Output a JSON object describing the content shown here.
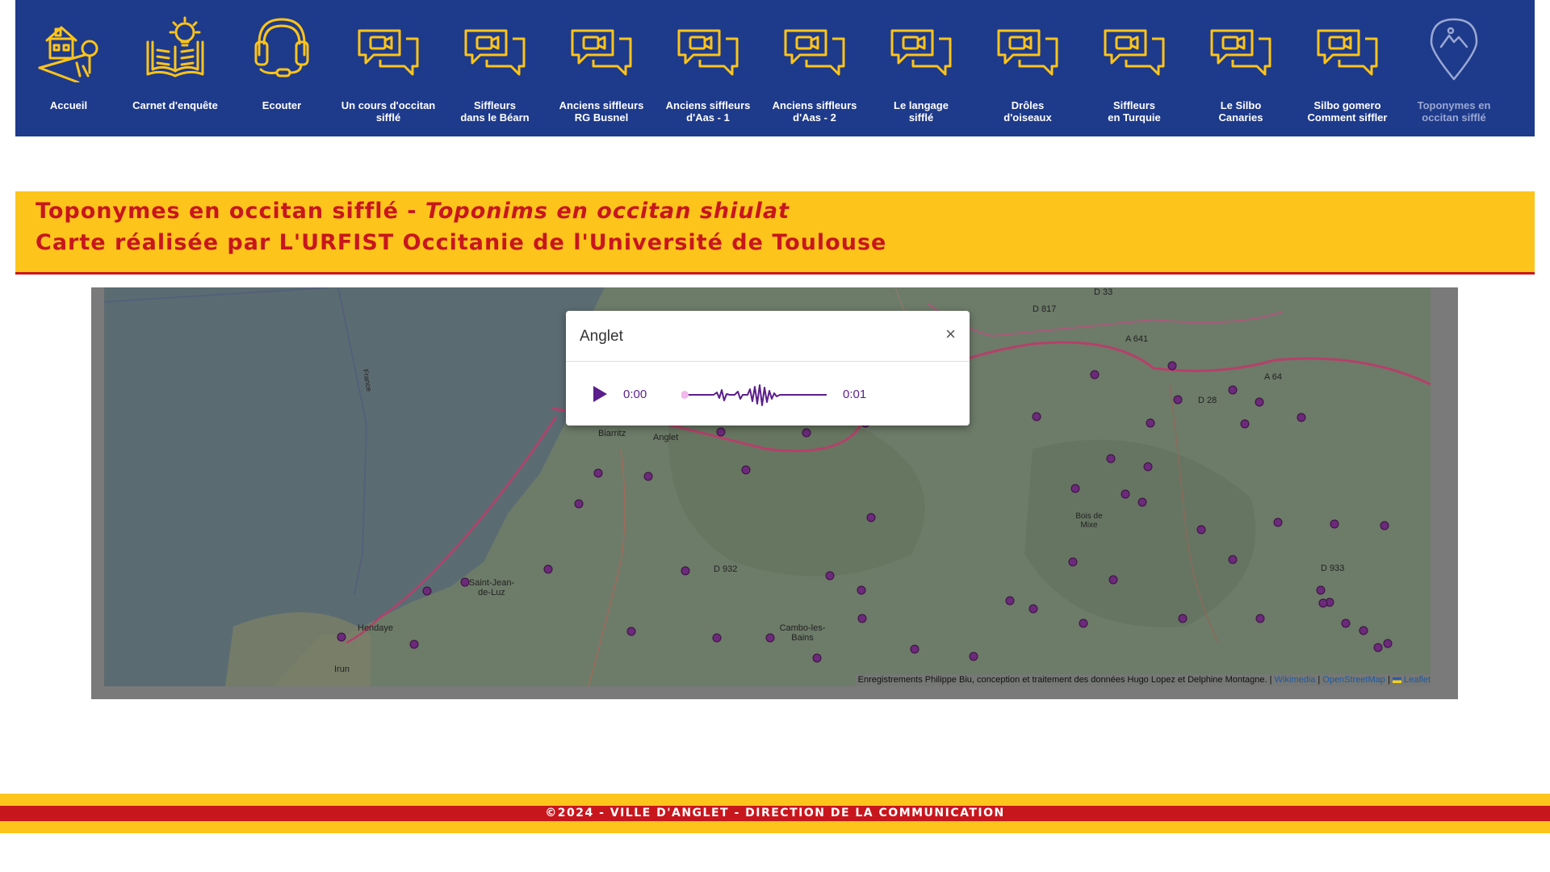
{
  "nav": {
    "items": [
      {
        "label1": "Accueil",
        "label2": "",
        "icon": "house-icon"
      },
      {
        "label1": "Carnet d'enquête",
        "label2": "",
        "icon": "notebook-idea-icon"
      },
      {
        "label1": "Ecouter",
        "label2": "",
        "icon": "headphones-icon"
      },
      {
        "label1": "Un cours d'occitan",
        "label2": "sifflé",
        "icon": "video-chat-icon"
      },
      {
        "label1": "Siffleurs",
        "label2": "dans le Béarn",
        "icon": "video-chat-icon"
      },
      {
        "label1": "Anciens siffleurs",
        "label2": "RG Busnel",
        "icon": "video-chat-icon"
      },
      {
        "label1": "Anciens siffleurs",
        "label2": "d'Aas - 1",
        "icon": "video-chat-icon"
      },
      {
        "label1": "Anciens siffleurs",
        "label2": "d'Aas - 2",
        "icon": "video-chat-icon"
      },
      {
        "label1": "Le langage",
        "label2": "sifflé",
        "icon": "video-chat-icon"
      },
      {
        "label1": "Drôles",
        "label2": "d'oiseaux",
        "icon": "video-chat-icon"
      },
      {
        "label1": "Siffleurs",
        "label2": "en Turquie",
        "icon": "video-chat-icon"
      },
      {
        "label1": "Le Silbo",
        "label2": "Canaries",
        "icon": "video-chat-icon"
      },
      {
        "label1": "Silbo gomero",
        "label2": "Comment siffler",
        "icon": "video-chat-icon"
      },
      {
        "label1": "Toponymes en",
        "label2": "occitan sifflé",
        "icon": "map-pin-icon",
        "active": true
      }
    ]
  },
  "banner": {
    "line1_fr": "Toponymes en occitan sifflé - ",
    "line1_oc": "Toponims en occitan shiulat",
    "line2": "Carte réalisée par L'URFIST Occitanie de l'Université de Toulouse"
  },
  "map": {
    "labels": [
      "D 33",
      "D 817",
      "A 641",
      "A 64",
      "D 28",
      "Biarritz",
      "Anglet",
      "Saint-Jean-de-Luz",
      "Hendaye",
      "Irun",
      "D 932",
      "Cambo-les-Bains",
      "D 933",
      "Bois de Mixe",
      "France"
    ],
    "attribution_text": "Enregistrements Philippe Biu, conception et traitement des données Hugo Lopez et Delphine Montagne. | ",
    "attribution_links": [
      "Wikimedia",
      "OpenStreetMap",
      "Leaflet"
    ],
    "marker_color": "#6b2a7a"
  },
  "popup": {
    "title": "Anglet",
    "close": "×",
    "time_current": "0:00",
    "time_duration": "0:01",
    "accent": "#5b1e8c"
  },
  "footer": {
    "text": "©2024 - VILLE D'ANGLET - DIRECTION DE LA COMMUNICATION"
  }
}
